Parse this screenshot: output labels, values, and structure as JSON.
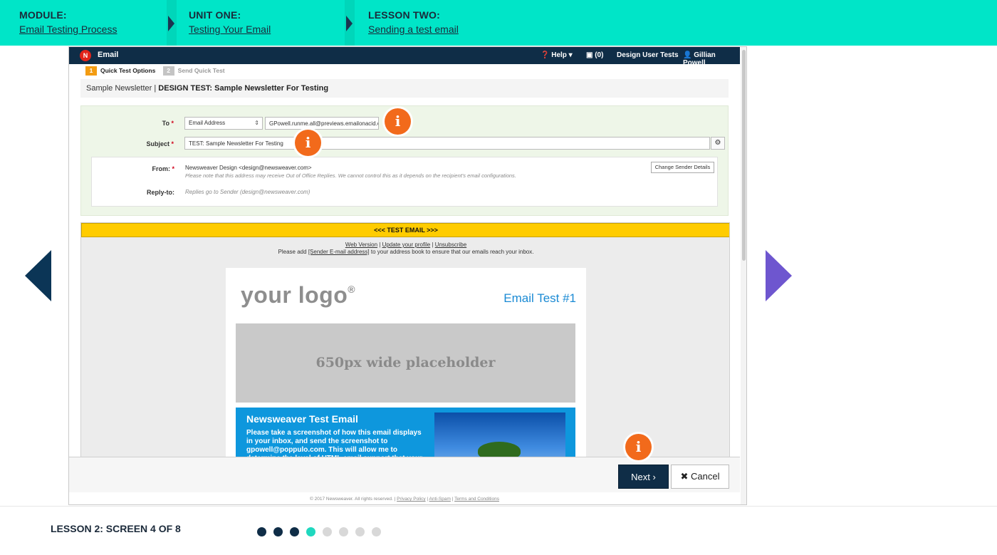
{
  "breadcrumb": {
    "module": {
      "key": "MODULE:",
      "value": "Email Testing Process"
    },
    "unit": {
      "key": "UNIT ONE:",
      "value": "Testing Your Email"
    },
    "lesson": {
      "key": "LESSON TWO:",
      "value": "Sending a test email"
    }
  },
  "app": {
    "logo": "N",
    "title": "Email",
    "help": "❓ Help ▾",
    "notifications": "▣ (0)",
    "account": "Design User Tests",
    "user": "👤 Gillian Powell"
  },
  "steps": [
    {
      "number": "1",
      "label": "Quick Test Options",
      "color": "#f39c12"
    },
    {
      "number": "2",
      "label": "Send Quick Test",
      "color": "#c4c4c4"
    }
  ],
  "page_title": {
    "prefix": "Sample Newsletter | ",
    "bold": "DESIGN TEST: Sample Newsletter For Testing"
  },
  "form": {
    "to_label": "To",
    "to_select": "Email Address",
    "to_value": "GPowell.runme.all@previews.emailonacid.c",
    "subject_label": "Subject",
    "subject_value": "TEST: Sample Newsletter For Testing",
    "from_label": "From:",
    "from_value": "Newsweaver Design <design@newsweaver.com>",
    "from_note": "Please note that this address may receive Out of Office Replies. We cannot control this as it depends on the recipient's email configurations.",
    "reply_label": "Reply-to:",
    "reply_value": "Replies go to Sender (design@newsweaver.com)",
    "change_sender": "Change Sender Details",
    "required_mark": "*"
  },
  "info_pins": {
    "symbol": "i"
  },
  "preview": {
    "banner": "<<< TEST EMAIL >>>",
    "link_web": "Web Version",
    "link_profile": "Update your profile",
    "link_unsub": "Unsubscribe",
    "sep": " | ",
    "note_prefix": "Please add ",
    "note_link": "[Sender E-mail address]",
    "note_suffix": " to your address book to ensure that our emails reach your inbox.",
    "logo_text": "your logo",
    "logo_mark": "®",
    "email_title": "Email Test #1",
    "placeholder": "650px wide placeholder",
    "box_title": "Newsweaver Test Email",
    "box_body": "Please take a screenshot of how this email displays in your inbox, and send the screenshot to gpowell@poppulo.com. This will allow me to determine the level of HTML email support that your"
  },
  "actions": {
    "next": "Next ›",
    "cancel": "✖ Cancel"
  },
  "footer": {
    "copyright": "© 2017 Newsweaver. All rights reserved. | ",
    "privacy": "Privacy Policy",
    "antispam": "Anti-Spam",
    "terms": "Terms and Conditions",
    "sep": " | "
  },
  "progress": {
    "label": "LESSON 2: SCREEN 4 OF 8",
    "dots": [
      {
        "state": "done",
        "color": "#0f2d47"
      },
      {
        "state": "done",
        "color": "#0f2d47"
      },
      {
        "state": "done",
        "color": "#0f2d47"
      },
      {
        "state": "current",
        "color": "#1fd8bf"
      },
      {
        "state": "todo",
        "color": "#d8d8d8"
      },
      {
        "state": "todo",
        "color": "#d8d8d8"
      },
      {
        "state": "todo",
        "color": "#d8d8d8"
      },
      {
        "state": "todo",
        "color": "#d8d8d8"
      }
    ]
  },
  "colors": {
    "teal_bar": "#00e5c8",
    "navy": "#0f2d47",
    "prev_arrow": "#0b3556",
    "next_arrow": "#6e56cf",
    "info_orange": "#f26a1b",
    "test_banner": "#ffcc00"
  }
}
